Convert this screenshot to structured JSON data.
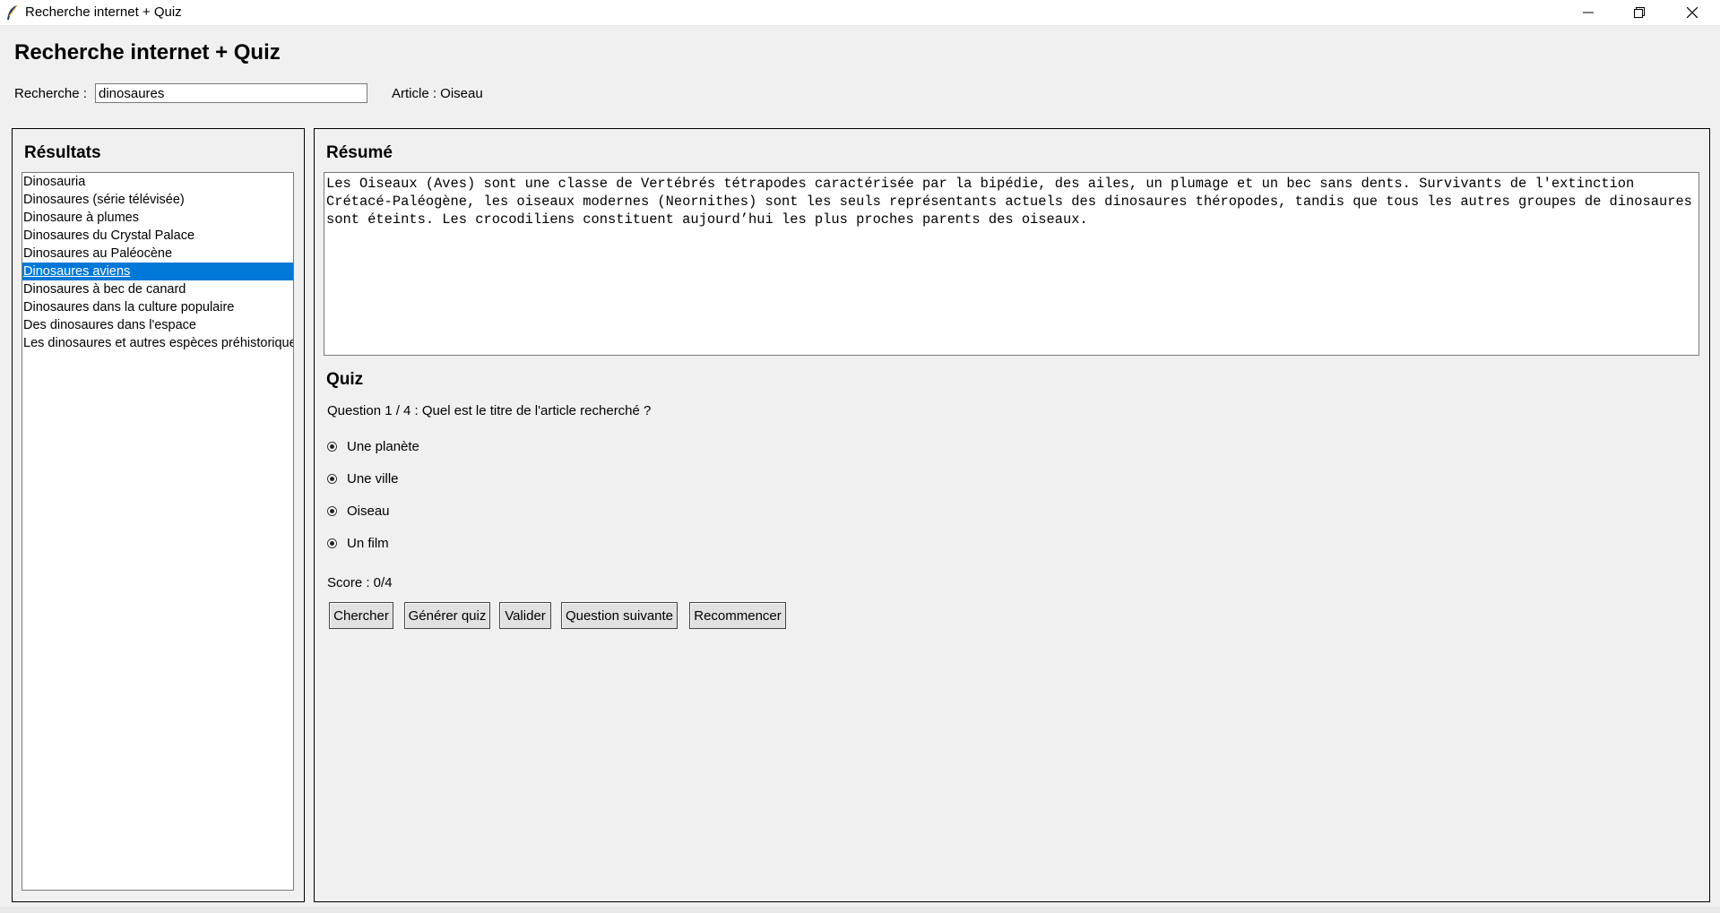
{
  "window": {
    "title": "Recherche internet + Quiz",
    "controls": [
      "minimize-icon",
      "maximize-icon",
      "close-icon"
    ]
  },
  "header": {
    "heading": "Recherche internet + Quiz",
    "search_label": "Recherche :",
    "search_value": "dinosaures",
    "article_label": "Article : Oiseau"
  },
  "results": {
    "title": "Résultats",
    "items": [
      "Dinosauria",
      "Dinosaures (série télévisée)",
      "Dinosaure à plumes",
      "Dinosaures du Crystal Palace",
      "Dinosaures au Paléocène",
      "Dinosaures aviens",
      "Dinosaures à bec de canard",
      "Dinosaures dans la culture populaire",
      "Des dinosaures dans l'espace",
      "Les dinosaures et autres espèces préhistoriques"
    ],
    "selected_index": 5
  },
  "summary": {
    "title": "Résumé",
    "text": "Les Oiseaux (Aves) sont une classe de Vertébrés tétrapodes caractérisée par la bipédie, des ailes, un plumage et un bec sans dents. Survivants de l'extinction Crétacé-Paléogène, les oiseaux modernes (Neornithes) sont les seuls représentants actuels des dinosaures théropodes, tandis que tous les autres groupes de dinosaures sont éteints. Les crocodiliens constituent aujourd’hui les plus proches parents des oiseaux."
  },
  "quiz": {
    "title": "Quiz",
    "question": "Question 1 / 4 : Quel est le titre de l'article recherché ?",
    "options": [
      "Une planète",
      "Une ville",
      "Oiseau",
      "Un film"
    ],
    "score": "Score : 0/4"
  },
  "buttons": {
    "search": "Chercher",
    "generate": "Générer quiz",
    "validate": "Valider",
    "next": "Question suivante",
    "restart": "Recommencer"
  },
  "colors": {
    "selection": "#0078d7",
    "background": "#f0f0f0"
  }
}
